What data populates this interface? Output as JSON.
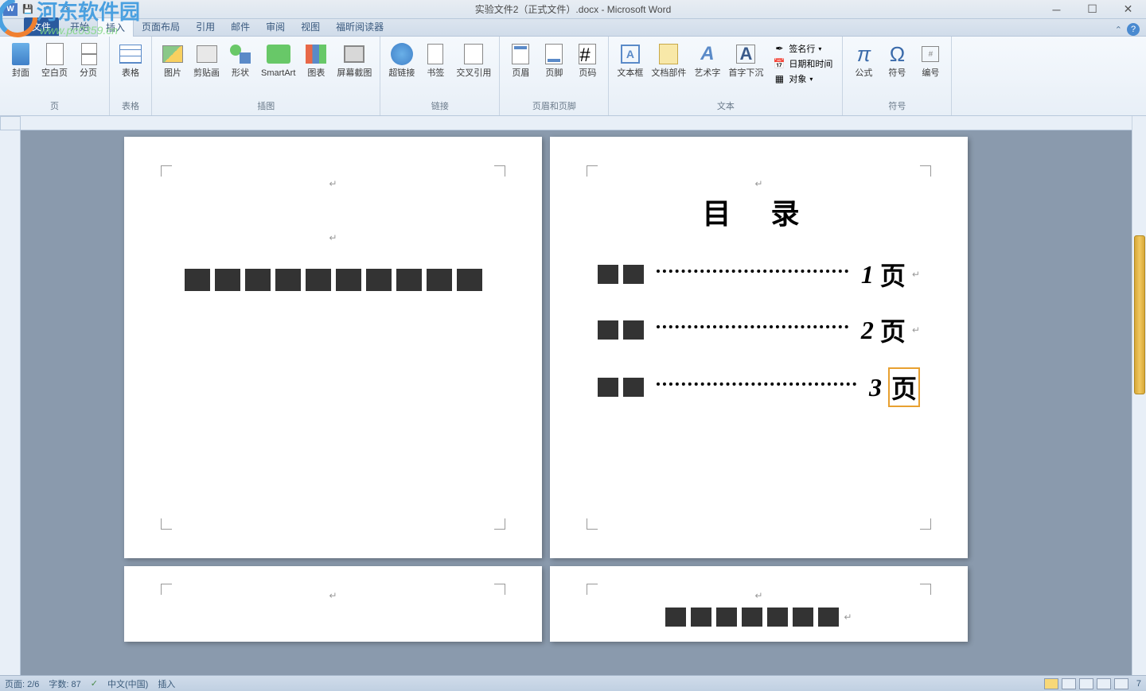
{
  "titlebar": {
    "title": "实验文件2（正式文件）.docx - Microsoft Word"
  },
  "tabs": {
    "file": "文件",
    "items": [
      "开始",
      "插入",
      "页面布局",
      "引用",
      "邮件",
      "审阅",
      "视图",
      "福昕阅读器"
    ],
    "active_index": 1
  },
  "ribbon": {
    "groups": [
      {
        "label": "页",
        "items": [
          "封面",
          "空白页",
          "分页"
        ]
      },
      {
        "label": "表格",
        "items": [
          "表格"
        ]
      },
      {
        "label": "插图",
        "items": [
          "图片",
          "剪贴画",
          "形状",
          "SmartArt",
          "图表",
          "屏幕截图"
        ]
      },
      {
        "label": "链接",
        "items": [
          "超链接",
          "书签",
          "交叉引用"
        ]
      },
      {
        "label": "页眉和页脚",
        "items": [
          "页眉",
          "页脚",
          "页码"
        ]
      },
      {
        "label": "文本",
        "items": [
          "文本框",
          "文档部件",
          "艺术字",
          "首字下沉"
        ],
        "small": [
          "签名行",
          "日期和时间",
          "对象"
        ]
      },
      {
        "label": "符号",
        "items": [
          "公式",
          "符号",
          "编号"
        ]
      }
    ]
  },
  "document": {
    "toc_title": "目 录",
    "toc_lines": [
      {
        "num": "1",
        "page": "页"
      },
      {
        "num": "2",
        "page": "页"
      },
      {
        "num": "3",
        "page": "页"
      }
    ]
  },
  "statusbar": {
    "page": "页面: 2/6",
    "words": "字数: 87",
    "lang": "中文(中国)",
    "mode": "插入",
    "zoom": "7"
  },
  "watermark": {
    "brand": "河东软件园",
    "url": "www.pc0359.cn"
  }
}
